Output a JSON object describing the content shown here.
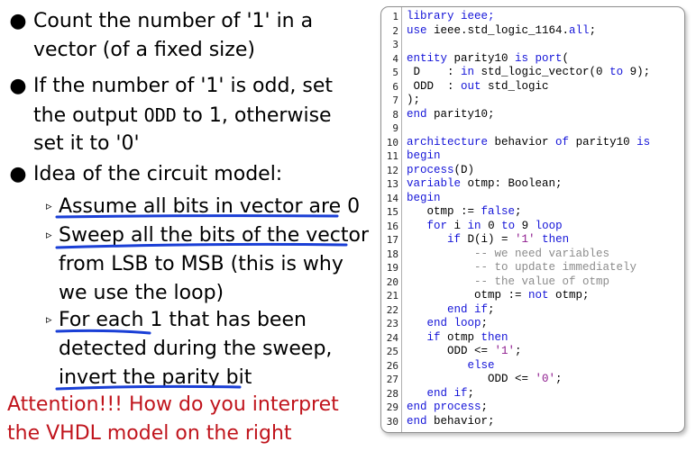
{
  "bullets": [
    {
      "lines": [
        "Count the number of '1' in a",
        "vector (of a fixed size)"
      ]
    },
    {
      "lines": [
        "If the number of '1' is odd, set",
        "the output",
        "ODD",
        "to 1, otherwise",
        "set it to '0'"
      ]
    },
    {
      "lines": [
        "Idea of the circuit model:"
      ]
    }
  ],
  "sub_bullets": [
    {
      "lines": [
        "Assume all bits in vector are 0"
      ]
    },
    {
      "lines": [
        "Sweep all the bits of the vector",
        "from LSB to MSB (this is why",
        "we use the loop)"
      ]
    },
    {
      "lines": [
        "For each 1",
        "that has been",
        "detected during the sweep,",
        "invert the parity bit"
      ]
    }
  ],
  "attention": [
    "Attention!!! How do you interpret",
    "the VHDL model on the right"
  ],
  "colors": {
    "attention": "#c0141c",
    "keyword": "#1515d8",
    "string": "#8e1b8e",
    "comment": "#8c8c8c",
    "ink": "#1a3fd6"
  },
  "code": {
    "line_numbers": [
      "1",
      "2",
      "3",
      "4",
      "5",
      "6",
      "7",
      "8",
      "9",
      "10",
      "11",
      "12",
      "13",
      "14",
      "15",
      "16",
      "17",
      "18",
      "19",
      "20",
      "21",
      "22",
      "23",
      "24",
      "25",
      "26",
      "27",
      "28",
      "29",
      "30"
    ],
    "lines": [
      [
        [
          "kw",
          "library ieee;"
        ]
      ],
      [
        [
          "kw",
          "use "
        ],
        [
          "n",
          "ieee.std_logic_1164."
        ],
        [
          "kw",
          "all"
        ],
        [
          "n",
          ";"
        ]
      ],
      [],
      [
        [
          "kw",
          "entity "
        ],
        [
          "n",
          "parity10 "
        ],
        [
          "kw",
          "is port"
        ],
        [
          "n",
          "("
        ]
      ],
      [
        [
          "n",
          " D    : "
        ],
        [
          "kw",
          "in "
        ],
        [
          "n",
          "std_logic_vector(0 "
        ],
        [
          "kw",
          "to "
        ],
        [
          "n",
          "9);"
        ]
      ],
      [
        [
          "n",
          " ODD  : "
        ],
        [
          "kw",
          "out "
        ],
        [
          "n",
          "std_logic"
        ]
      ],
      [
        [
          "n",
          ");"
        ]
      ],
      [
        [
          "kw",
          "end "
        ],
        [
          "n",
          "parity10;"
        ]
      ],
      [],
      [
        [
          "kw",
          "architecture "
        ],
        [
          "n",
          "behavior "
        ],
        [
          "kw",
          "of "
        ],
        [
          "n",
          "parity10 "
        ],
        [
          "kw",
          "is"
        ]
      ],
      [
        [
          "kw",
          "begin"
        ]
      ],
      [
        [
          "kw",
          "process"
        ],
        [
          "n",
          "(D)"
        ]
      ],
      [
        [
          "kw",
          "variable "
        ],
        [
          "n",
          "otmp: Boolean;"
        ]
      ],
      [
        [
          "kw",
          "begin"
        ]
      ],
      [
        [
          "n",
          "   otmp := "
        ],
        [
          "kw",
          "false"
        ],
        [
          "n",
          ";"
        ]
      ],
      [
        [
          "n",
          "   "
        ],
        [
          "kw",
          "for "
        ],
        [
          "n",
          "i "
        ],
        [
          "kw",
          "in "
        ],
        [
          "n",
          "0 "
        ],
        [
          "kw",
          "to "
        ],
        [
          "n",
          "9 "
        ],
        [
          "kw",
          "loop"
        ]
      ],
      [
        [
          "n",
          "      "
        ],
        [
          "kw",
          "if "
        ],
        [
          "n",
          "D(i) = "
        ],
        [
          "str",
          "'1'"
        ],
        [
          "n",
          " "
        ],
        [
          "kw",
          "then"
        ]
      ],
      [
        [
          "cmt",
          "          -- we need variables"
        ]
      ],
      [
        [
          "cmt",
          "          -- to update immediately"
        ]
      ],
      [
        [
          "cmt",
          "          -- the value of otmp"
        ]
      ],
      [
        [
          "n",
          "          otmp := "
        ],
        [
          "kw",
          "not "
        ],
        [
          "n",
          "otmp;"
        ]
      ],
      [
        [
          "n",
          "      "
        ],
        [
          "kw",
          "end if"
        ],
        [
          "n",
          ";"
        ]
      ],
      [
        [
          "n",
          "   "
        ],
        [
          "kw",
          "end loop"
        ],
        [
          "n",
          ";"
        ]
      ],
      [
        [
          "n",
          "   "
        ],
        [
          "kw",
          "if "
        ],
        [
          "n",
          "otmp "
        ],
        [
          "kw",
          "then"
        ]
      ],
      [
        [
          "n",
          "      ODD <= "
        ],
        [
          "str",
          "'1'"
        ],
        [
          "n",
          ";"
        ]
      ],
      [
        [
          "n",
          "         "
        ],
        [
          "kw",
          "else"
        ]
      ],
      [
        [
          "n",
          "            ODD <= "
        ],
        [
          "str",
          "'0'"
        ],
        [
          "n",
          ";"
        ]
      ],
      [
        [
          "n",
          "   "
        ],
        [
          "kw",
          "end if"
        ],
        [
          "n",
          ";"
        ]
      ],
      [
        [
          "kw",
          "end process"
        ],
        [
          "n",
          ";"
        ]
      ],
      [
        [
          "kw",
          "end "
        ],
        [
          "n",
          "behavior;"
        ]
      ]
    ]
  }
}
